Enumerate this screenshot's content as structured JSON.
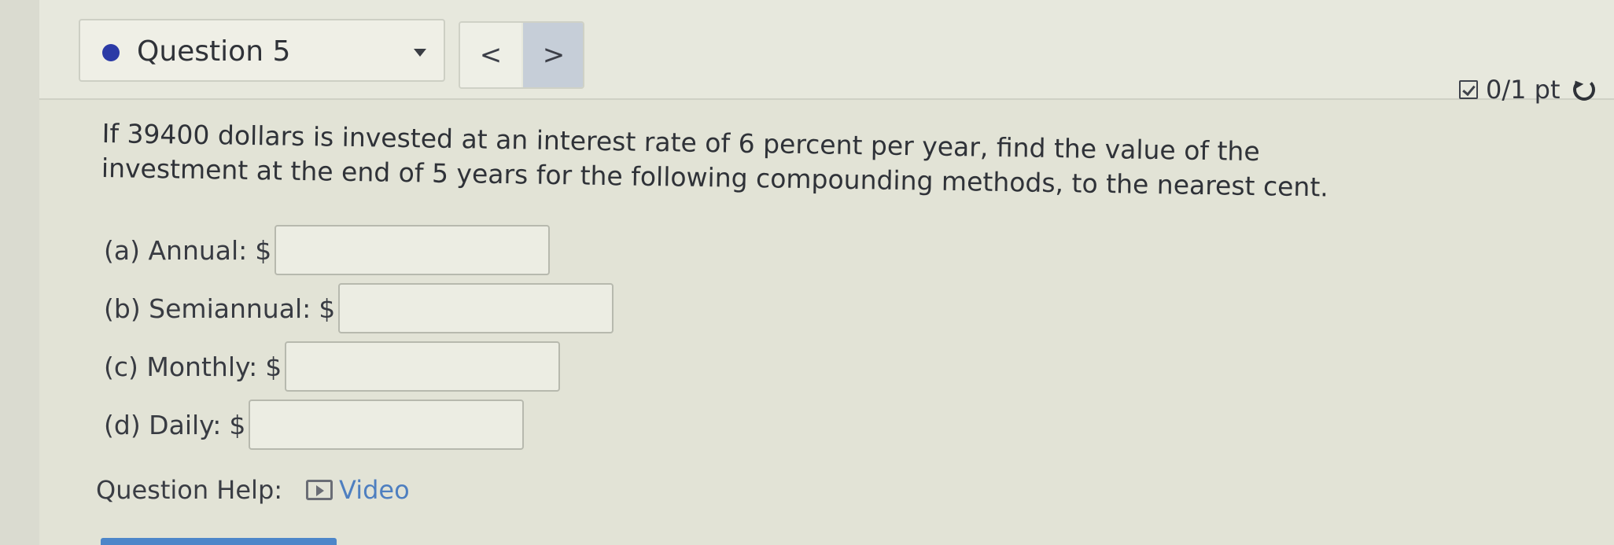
{
  "header": {
    "question_label": "Question 5",
    "prev_label": "<",
    "next_label": ">",
    "score": "0/1 pt"
  },
  "question": {
    "prompt": "If 39400 dollars is invested at an interest rate of 6 percent per year, find the value of the investment at the end of 5 years for the following compounding methods, to the nearest cent.",
    "currency": "$",
    "answers": [
      {
        "label": "(a) Annual:",
        "value": ""
      },
      {
        "label": "(b) Semiannual:",
        "value": ""
      },
      {
        "label": "(c) Monthly:",
        "value": ""
      },
      {
        "label": "(d) Daily:",
        "value": ""
      }
    ]
  },
  "help": {
    "label": "Question Help:",
    "video_label": "Video"
  },
  "colors": {
    "status_dot": "#2b3aa6",
    "link": "#4e7fc0",
    "next_button": "#c6ced8"
  }
}
